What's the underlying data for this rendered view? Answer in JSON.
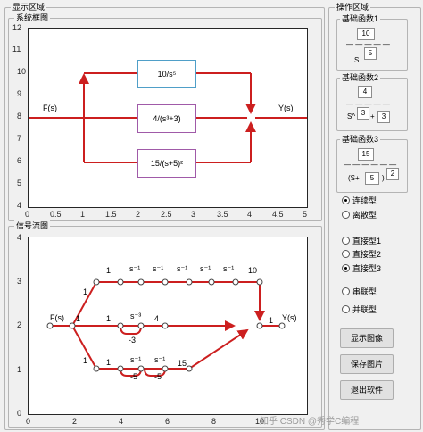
{
  "display_panel": {
    "title": "显示区域"
  },
  "block_diagram": {
    "title": "系统框图",
    "input_label": "F(s)",
    "output_label": "Y(s)",
    "blocks": [
      "10/s⁵",
      "4/(s³+3)",
      "15/(s+5)²"
    ],
    "block_colors": [
      "#4f9fc8",
      "#a05aa8",
      "#a05aa8"
    ],
    "line_color": "#cc1f1f",
    "x_ticks": [
      "0",
      "0.5",
      "1",
      "1.5",
      "2",
      "2.5",
      "3",
      "3.5",
      "4",
      "4.5",
      "5"
    ],
    "y_ticks": [
      "4",
      "5",
      "6",
      "7",
      "8",
      "9",
      "10",
      "11",
      "12"
    ]
  },
  "signal_flow": {
    "title": "信号流图",
    "input_label": "F(s)",
    "output_label": "Y(s)",
    "top_branch": [
      "1",
      "1",
      "s⁻¹",
      "s⁻¹",
      "s⁻¹",
      "s⁻¹",
      "s⁻¹",
      "10"
    ],
    "middle_branch": [
      "1",
      "1",
      "s⁻³",
      "4"
    ],
    "middle_feedback": "-3",
    "bottom_branch": [
      "1",
      "1",
      "s⁻¹",
      "s⁻¹",
      "15"
    ],
    "bottom_feedbacks": [
      "-5",
      "-5"
    ],
    "output_gain": "1",
    "x_ticks": [
      "0",
      "2",
      "4",
      "6",
      "8",
      "10"
    ],
    "y_ticks": [
      "0",
      "1",
      "2",
      "3",
      "4"
    ]
  },
  "control_panel": {
    "title": "操作区域",
    "tf1": {
      "title": "基础函数1",
      "numerator": "10",
      "denominator_prefix": "S",
      "exponent": "5",
      "divider": "— — — — —"
    },
    "tf2": {
      "title": "基础函数2",
      "numerator": "4",
      "denominator_prefix": "S^",
      "exponent": "3",
      "plus": "+",
      "constant": "3",
      "divider": "— — — — —"
    },
    "tf3": {
      "title": "基础函数3",
      "numerator": "15",
      "open": "(S+",
      "constant": "5",
      "close": ")",
      "exponent": "2",
      "divider": "— — — — — —"
    },
    "type_options": [
      {
        "label": "连续型",
        "selected": true
      },
      {
        "label": "离散型",
        "selected": false
      }
    ],
    "form_options": [
      {
        "label": "直接型1",
        "selected": false
      },
      {
        "label": "直接型2",
        "selected": false
      },
      {
        "label": "直接型3",
        "selected": true
      }
    ],
    "struct_options": [
      {
        "label": "串联型",
        "selected": false
      },
      {
        "label": "并联型",
        "selected": false
      }
    ],
    "buttons": [
      "显示图像",
      "保存图片",
      "退出软件"
    ]
  },
  "watermark": "知乎 CSDN @秀学C编程"
}
